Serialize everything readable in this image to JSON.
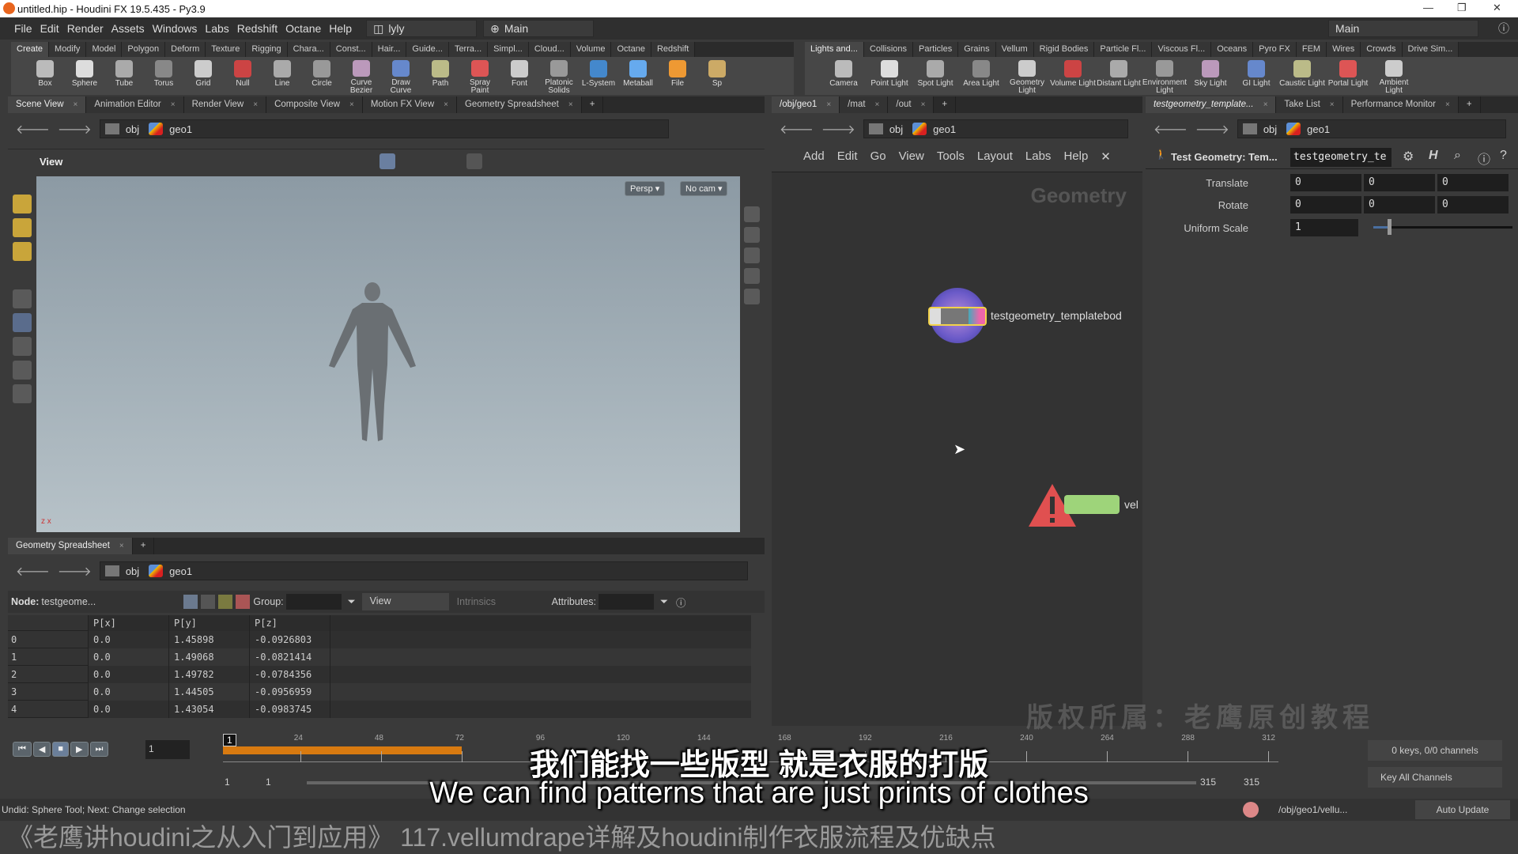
{
  "window": {
    "title": "untitled.hip - Houdini FX 19.5.435 - Py3.9"
  },
  "menu": {
    "items": [
      "File",
      "Edit",
      "Render",
      "Assets",
      "Windows",
      "Labs",
      "Redshift",
      "Octane",
      "Help"
    ],
    "desktop": "lyly",
    "context": "Main",
    "right_context": "Main"
  },
  "shelf_left": {
    "tabs": [
      "Create",
      "Modify",
      "Model",
      "Polygon",
      "Deform",
      "Texture",
      "Rigging",
      "Chara...",
      "Const...",
      "Hair...",
      "Guide...",
      "Terra...",
      "Simpl...",
      "Cloud...",
      "Volume",
      "Octane",
      "Redshift"
    ],
    "tools": [
      "Box",
      "Sphere",
      "Tube",
      "Torus",
      "Grid",
      "Null",
      "Line",
      "Circle",
      "Curve Bezier",
      "Draw Curve",
      "Path",
      "Spray Paint",
      "Font",
      "Platonic Solids",
      "L-System",
      "Metaball",
      "File",
      "Sp"
    ]
  },
  "shelf_right": {
    "tabs": [
      "Lights and...",
      "Collisions",
      "Particles",
      "Grains",
      "Vellum",
      "Rigid Bodies",
      "Particle Fl...",
      "Viscous Fl...",
      "Oceans",
      "Pyro FX",
      "FEM",
      "Wires",
      "Crowds",
      "Drive Sim..."
    ],
    "tools": [
      "Camera",
      "Point Light",
      "Spot Light",
      "Area Light",
      "Geometry Light",
      "Volume Light",
      "Distant Light",
      "Environment Light",
      "Sky Light",
      "GI Light",
      "Caustic Light",
      "Portal Light",
      "Ambient Light"
    ]
  },
  "left_pane": {
    "tabs": [
      "Scene View",
      "Animation Editor",
      "Render View",
      "Composite View",
      "Motion FX View",
      "Geometry Spreadsheet"
    ],
    "path": [
      "obj",
      "geo1"
    ],
    "view_label": "View",
    "persp": "Persp",
    "cam": "No cam"
  },
  "spreadsheet": {
    "tab": "Geometry Spreadsheet",
    "path": [
      "obj",
      "geo1"
    ],
    "node_label": "Node:",
    "node": "testgeome...",
    "group_label": "Group:",
    "view": "View",
    "intrinsics": "Intrinsics",
    "attributes_label": "Attributes:",
    "columns": [
      "",
      "P[x]",
      "P[y]",
      "P[z]"
    ],
    "rows": [
      [
        "0",
        "0.0",
        "1.45898",
        "-0.0926803"
      ],
      [
        "1",
        "0.0",
        "1.49068",
        "-0.0821414"
      ],
      [
        "2",
        "0.0",
        "1.49782",
        "-0.0784356"
      ],
      [
        "3",
        "0.0",
        "1.44505",
        "-0.0956959"
      ],
      [
        "4",
        "0.0",
        "1.43054",
        "-0.0983745"
      ]
    ]
  },
  "network": {
    "tabs": [
      "/obj/geo1",
      "/mat",
      "/out"
    ],
    "path": [
      "obj",
      "geo1"
    ],
    "menu": [
      "Add",
      "Edit",
      "Go",
      "View",
      "Tools",
      "Layout",
      "Labs",
      "Help"
    ],
    "context_label": "Geometry",
    "node1": "testgeometry_templatebod",
    "node2": "vel"
  },
  "params": {
    "tabs": [
      "testgeometry_template...",
      "Take List",
      "Performance Monitor"
    ],
    "path": [
      "obj",
      "geo1"
    ],
    "node_type": "Test Geometry: Tem...",
    "node_name": "testgeometry_te",
    "translate_label": "Translate",
    "translate": [
      "0",
      "0",
      "0"
    ],
    "rotate_label": "Rotate",
    "rotate": [
      "0",
      "0",
      "0"
    ],
    "scale_label": "Uniform Scale",
    "scale": "1",
    "scale_fraction": 0.1
  },
  "timeline": {
    "current_frame": "1",
    "ticks": [
      "24",
      "48",
      "72",
      "96",
      "120",
      "144",
      "168",
      "192",
      "216",
      "240",
      "264",
      "288",
      "312"
    ],
    "start": "1",
    "range_start": "1",
    "range_end": "315",
    "end": "315",
    "cached_end_frame": 72,
    "keys": "0 keys, 0/0 channels",
    "key_all": "Key All Channels",
    "accent": "#d87a10"
  },
  "status": {
    "message": "Undid: Sphere Tool; Next: Change selection",
    "node_path": "/obj/geo1/vellu...",
    "update": "Auto Update"
  },
  "overlay": {
    "subtitle_cn": "我们能找一些版型 就是衣服的打版",
    "subtitle_en": "We can find patterns that are just prints of clothes",
    "watermark": "版权所属：老鹰原创教程",
    "course_title": "《老鹰讲houdini之从入门到应用》 117.vellumdrape详解及houdini制作衣服流程及优缺点"
  }
}
